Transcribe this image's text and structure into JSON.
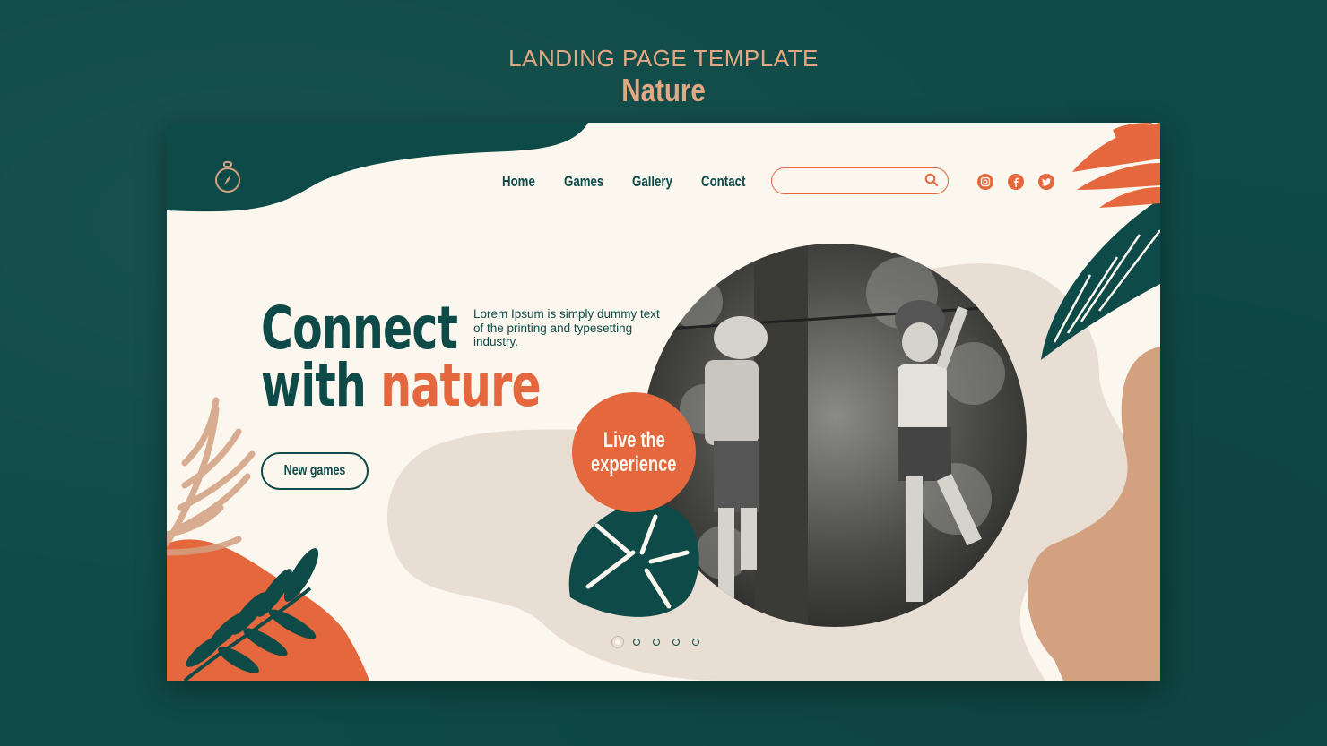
{
  "header": {
    "title": "LANDING PAGE TEMPLATE",
    "subtitle": "Nature"
  },
  "nav": {
    "items": [
      {
        "label": "Home"
      },
      {
        "label": "Games"
      },
      {
        "label": "Gallery"
      },
      {
        "label": "Contact"
      }
    ]
  },
  "search": {
    "value": "",
    "placeholder": ""
  },
  "social": [
    "instagram-icon",
    "facebook-icon",
    "twitter-icon"
  ],
  "hero": {
    "headline_line1": "Connect",
    "headline_line2_prefix": "with ",
    "headline_line2_accent": "nature",
    "description": "Lorem Ipsum is simply dummy text of the printing and typesetting industry.",
    "cta_label": "New games",
    "bubble_line1": "Live the",
    "bubble_line2": "experience"
  },
  "carousel": {
    "total": 5,
    "active": 1
  },
  "colors": {
    "background": "#0f4a47",
    "page": "#fbf6ee",
    "teal": "#0e4b48",
    "orange": "#e4673d",
    "beige": "#e9ded4",
    "tan": "#d3a080",
    "title": "#e2a883"
  }
}
